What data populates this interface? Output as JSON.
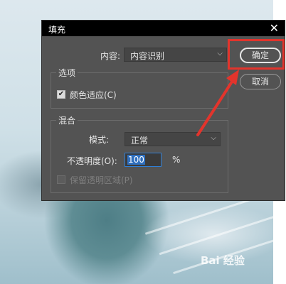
{
  "dialog": {
    "title": "填充",
    "close": "✕",
    "content_label": "内容:",
    "content_value": "内容识别",
    "options_group": "选项",
    "color_adapt_label": "颜色适应(C)",
    "color_adapt_checked": true,
    "blend_group": "混合",
    "mode_label": "模式:",
    "mode_value": "正常",
    "opacity_label": "不透明度(O):",
    "opacity_value": "100",
    "opacity_unit": "%",
    "preserve_transparency_label": "保留透明区域(P)",
    "preserve_transparency_checked": false,
    "ok_button": "确定",
    "cancel_button": "取消"
  },
  "annotation": {
    "color": "#e3342c"
  },
  "watermark": {
    "text": "Bai 经验"
  },
  "colors": {
    "dialog_bg": "#535353",
    "titlebar_bg": "#000000",
    "highlight": "#e3342c"
  }
}
